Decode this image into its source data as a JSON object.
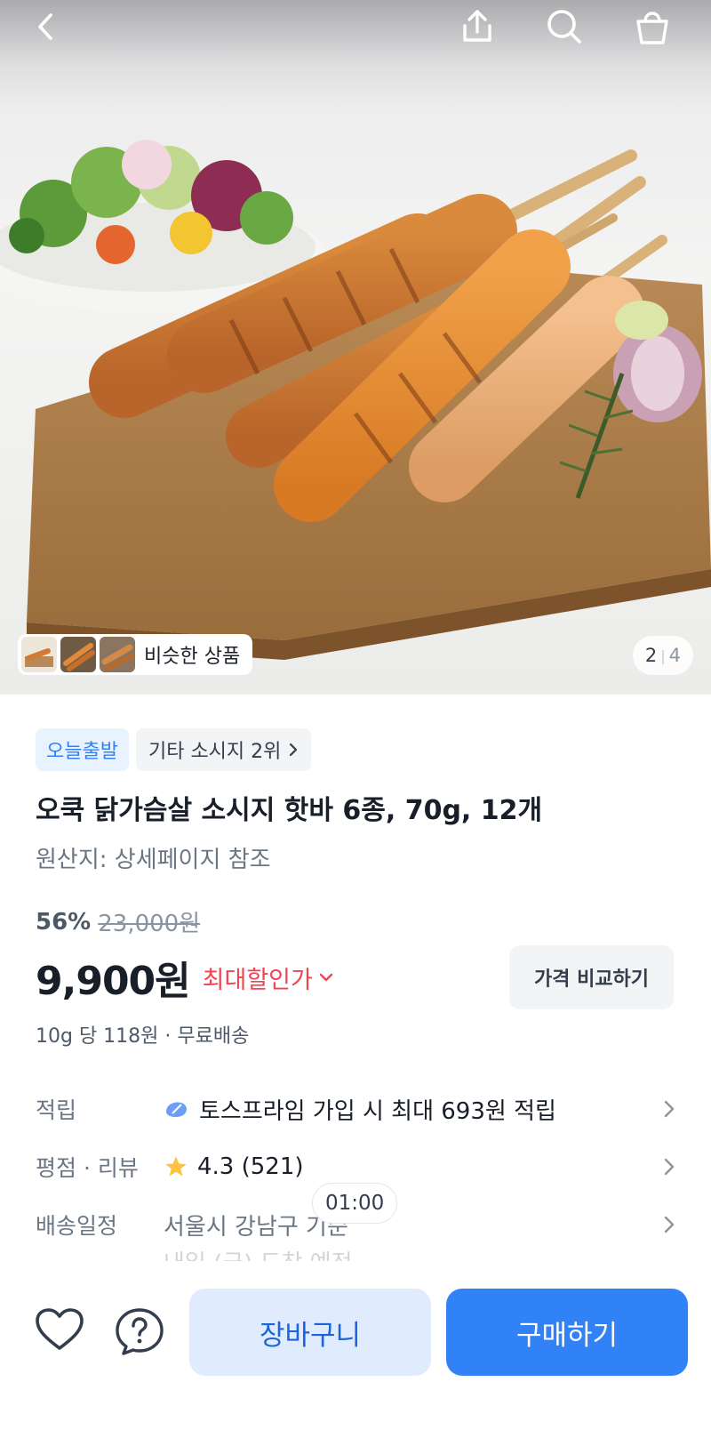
{
  "header": {
    "back_icon": "chevron-left-icon",
    "share_icon": "share-icon",
    "search_icon": "search-icon",
    "cart_icon": "shopping-bag-icon"
  },
  "gallery": {
    "similar_label": "비슷한 상품",
    "current_page": "2",
    "total_pages": "4"
  },
  "product": {
    "badge_today": "오늘출발",
    "badge_rank": "기타 소시지 2위",
    "title": "오쿡 닭가슴살 소시지 핫바 6종, 70g, 12개",
    "origin": "원산지: 상세페이지 참조",
    "discount_percent": "56%",
    "original_price": "23,000원",
    "price": "9,900원",
    "max_discount_label": "최대할인가",
    "compare_button": "가격 비교하기",
    "unit_price_line": "10g 당 118원 · 무료배송"
  },
  "info": {
    "points_label": "적립",
    "points_value": "토스프라임 가입 시 최대 693원 적립",
    "rating_label": "평점 · 리뷰",
    "rating_value": "4.3 (521)",
    "shipping_label": "배송일정",
    "shipping_value": "서울시 강남구 기준",
    "shipping_sub": "내일 (금) 도착 예정",
    "time_bubble": "01:00"
  },
  "bottom_bar": {
    "cart_button": "장바구니",
    "buy_button": "구매하기"
  },
  "colors": {
    "brand_blue": "#3182f6",
    "light_blue": "#e0ebfd",
    "discount_red": "#f04452",
    "star_yellow": "#ffc342"
  }
}
